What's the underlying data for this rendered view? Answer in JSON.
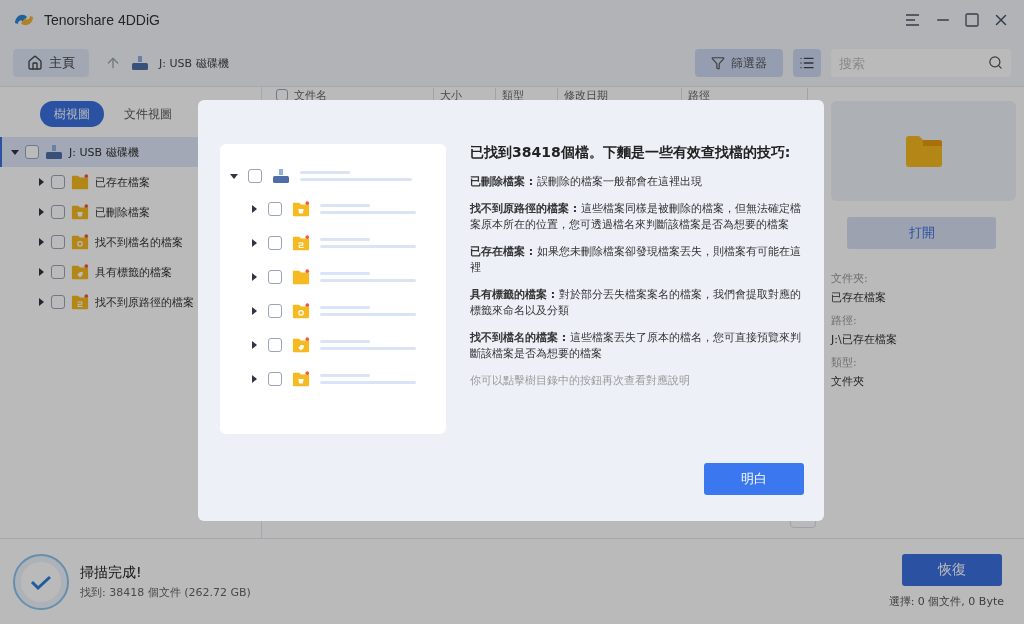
{
  "window": {
    "title": "Tenorshare 4DDiG"
  },
  "toolbar": {
    "home_button": "主頁",
    "location": "J: USB 磁碟機",
    "filter_button": "篩選器",
    "search": {
      "placeholder": "搜索"
    }
  },
  "view_tabs": [
    {
      "label": "樹視圖",
      "selected": true
    },
    {
      "label": "文件視圖",
      "selected": false
    }
  ],
  "tree": [
    {
      "label": "J: USB 磁碟機",
      "kind": "drive",
      "expanded": true,
      "selected": true,
      "checked": false,
      "children": [
        {
          "label": "已存在檔案",
          "kind": "existing",
          "expanded": false,
          "selected": false,
          "checked": false
        },
        {
          "label": "已刪除檔案",
          "kind": "deleted",
          "expanded": false,
          "selected": false,
          "checked": false
        },
        {
          "label": "找不到檔名的檔案",
          "kind": "unnamed",
          "expanded": false,
          "selected": false,
          "checked": false
        },
        {
          "label": "具有標籤的檔案",
          "kind": "tagged",
          "expanded": false,
          "selected": false,
          "checked": false
        },
        {
          "label": "找不到原路徑的檔案",
          "kind": "lost_path",
          "expanded": false,
          "selected": false,
          "checked": false
        }
      ]
    }
  ],
  "table": {
    "select_all_checked": false,
    "columns": [
      "文件名",
      "大小",
      "類型",
      "修改日期",
      "路徑"
    ]
  },
  "preview": {
    "open_button": "打開",
    "fields": [
      {
        "label": "文件夾:",
        "value": "已存在檔案"
      },
      {
        "label": "路徑:",
        "value": "J:\\已存在檔案"
      },
      {
        "label": "類型:",
        "value": "文件夾"
      }
    ]
  },
  "status": {
    "title": "掃描完成!",
    "detail": "找到: 38418 個文件 (262.72 GB)",
    "recover_button": "恢復",
    "selection": "選擇: 0 個文件, 0 Byte"
  },
  "dialog": {
    "title": "已找到38418個檔。下麵是一些有效查找檔的技巧:",
    "tips": [
      "**已刪除檔案 :** 誤刪除的檔案一般都會在這裡出現",
      "**找不到原路徑的檔案 :** 這些檔案同樣是被刪除的檔案，但無法確定檔案原本所在的位置，您可透過檔名來判斷該檔案是否為想要的檔案",
      "**已存在檔案 :** 如果您未刪除檔案卻發現檔案丟失，則檔案有可能在這裡",
      "**具有標籤的檔案 :** 對於部分丟失檔案案名的檔案，我們會提取對應的標籤來命名以及分類",
      "**找不到檔名的檔案 :** 這些檔案丟失了原本的檔名，您可直接預覽來判斷該檔案是否為想要的檔案"
    ],
    "note": "你可以點擊樹目錄中的按鈕再次查看對應說明",
    "ok_button": "明白"
  }
}
